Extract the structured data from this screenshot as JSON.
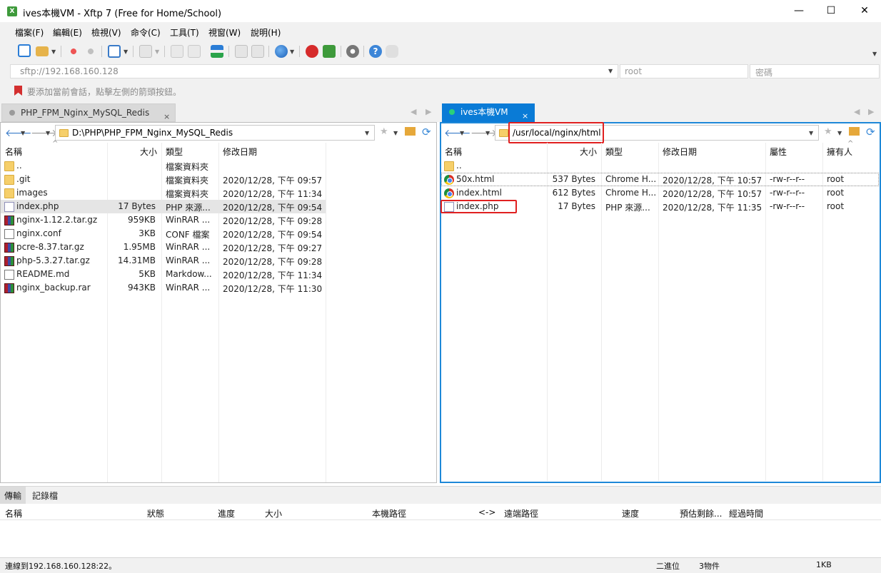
{
  "window": {
    "title": "ives本機VM - Xftp 7 (Free for Home/School)",
    "minimize": "—",
    "maximize": "☐",
    "close": "✕"
  },
  "menu": [
    "檔案(F)",
    "編輯(E)",
    "檢視(V)",
    "命令(C)",
    "工具(T)",
    "視窗(W)",
    "說明(H)"
  ],
  "address": {
    "value": "sftp://192.168.160.128",
    "user_placeholder": "root",
    "password_placeholder": "密碼"
  },
  "hint": "要添加當前會話，點擊左側的箭頭按鈕。",
  "tabs": {
    "left": "PHP_FPM_Nginx_MySQL_Redis",
    "right": "ives本機VM",
    "close": "×"
  },
  "left_pane": {
    "path": "D:\\PHP\\PHP_FPM_Nginx_MySQL_Redis",
    "columns": [
      "名稱",
      "大小",
      "類型",
      "修改日期"
    ],
    "rows": [
      {
        "name": "..",
        "size": "",
        "type": "檔案資料夾",
        "date": "",
        "icon": "folder"
      },
      {
        "name": ".git",
        "size": "",
        "type": "檔案資料夾",
        "date": "2020/12/28, 下午 09:57",
        "icon": "folder"
      },
      {
        "name": "images",
        "size": "",
        "type": "檔案資料夾",
        "date": "2020/12/28, 下午 11:34",
        "icon": "folder"
      },
      {
        "name": "index.php",
        "size": "17 Bytes",
        "type": "PHP 來源...",
        "date": "2020/12/28, 下午 09:54",
        "icon": "php"
      },
      {
        "name": "nginx-1.12.2.tar.gz",
        "size": "959KB",
        "type": "WinRAR ...",
        "date": "2020/12/28, 下午 09:28",
        "icon": "rar"
      },
      {
        "name": "nginx.conf",
        "size": "3KB",
        "type": "CONF 檔案",
        "date": "2020/12/28, 下午 09:54",
        "icon": "doc"
      },
      {
        "name": "pcre-8.37.tar.gz",
        "size": "1.95MB",
        "type": "WinRAR ...",
        "date": "2020/12/28, 下午 09:27",
        "icon": "rar"
      },
      {
        "name": "php-5.3.27.tar.gz",
        "size": "14.31MB",
        "type": "WinRAR ...",
        "date": "2020/12/28, 下午 09:28",
        "icon": "rar"
      },
      {
        "name": "README.md",
        "size": "5KB",
        "type": "Markdow...",
        "date": "2020/12/28, 下午 11:34",
        "icon": "md"
      },
      {
        "name": "nginx_backup.rar",
        "size": "943KB",
        "type": "WinRAR ...",
        "date": "2020/12/28, 下午 11:30",
        "icon": "rar"
      }
    ]
  },
  "right_pane": {
    "path": "/usr/local/nginx/html",
    "columns": [
      "名稱",
      "大小",
      "類型",
      "修改日期",
      "屬性",
      "擁有人"
    ],
    "rows": [
      {
        "name": "..",
        "size": "",
        "type": "",
        "date": "",
        "attr": "",
        "owner": "",
        "icon": "folder"
      },
      {
        "name": "50x.html",
        "size": "537 Bytes",
        "type": "Chrome H...",
        "date": "2020/12/28, 下午 10:57",
        "attr": "-rw-r--r--",
        "owner": "root",
        "icon": "chrome"
      },
      {
        "name": "index.html",
        "size": "612 Bytes",
        "type": "Chrome H...",
        "date": "2020/12/28, 下午 10:57",
        "attr": "-rw-r--r--",
        "owner": "root",
        "icon": "chrome"
      },
      {
        "name": "index.php",
        "size": "17 Bytes",
        "type": "PHP 來源...",
        "date": "2020/12/28, 下午 11:35",
        "attr": "-rw-r--r--",
        "owner": "root",
        "icon": "php"
      }
    ]
  },
  "bottom": {
    "tabs": [
      "傳輸",
      "記錄檔"
    ],
    "columns": [
      "名稱",
      "狀態",
      "進度",
      "大小",
      "本機路徑",
      "<->",
      "遠端路徑",
      "速度",
      "預估剩餘...",
      "經過時間"
    ]
  },
  "status": {
    "connection": "連線到192.168.160.128:22。",
    "mode": "二進位",
    "count": "3物件",
    "size": "1KB"
  },
  "colors": {
    "accent": "#0a7bd6",
    "highlight": "#e02020",
    "selected_row": "#e5e5e5"
  }
}
